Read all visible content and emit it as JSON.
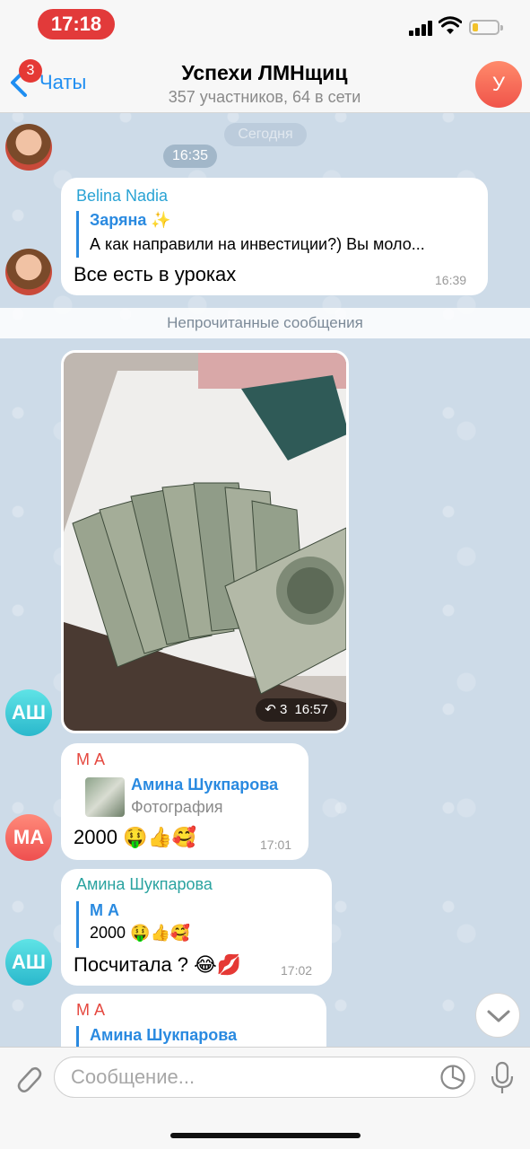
{
  "status_bar": {
    "time": "17:18"
  },
  "header": {
    "back_label": "Чаты",
    "unread_badge": "3",
    "title": "Успехи ЛМНщиц",
    "subtitle": "357 участников, 64 в сети",
    "avatar_letter": "У"
  },
  "date_pill": "Сегодня",
  "time_pill": "16:35",
  "messages": [
    {
      "sender": "Belina Nadia",
      "reply_name": "Заряна ✨",
      "reply_text": "А как направили на инвестиции?) Вы моло...",
      "text": "Все есть в уроках",
      "time": "16:39"
    },
    {
      "photo_forward_count": "3",
      "time": "16:57",
      "avatar_letters": "АШ"
    },
    {
      "sender": "М А",
      "reply_name": "Амина Шукпарова",
      "reply_text": "Фотография",
      "text": "2000 🤑👍🥰",
      "time": "17:01",
      "avatar_letters": "МА"
    },
    {
      "sender": "Амина Шукпарова",
      "reply_name": "М А",
      "reply_text": "2000 🤑👍🥰",
      "text": "Посчитала ? 😂💋",
      "time": "17:02",
      "avatar_letters": "АШ"
    },
    {
      "sender": "М А",
      "reply_name": "Амина Шукпарова"
    }
  ],
  "unread_divider": "Непрочитанные сообщения",
  "input": {
    "placeholder": "Сообщение..."
  },
  "colors": {
    "accent": "#1f8ef1",
    "badge": "#e53935",
    "sender_blue": "#2aa3d4",
    "sender_red": "#e5483f",
    "sender_teal": "#2aa3a0"
  }
}
